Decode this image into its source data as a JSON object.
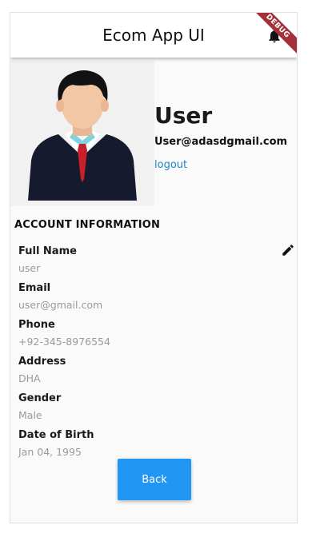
{
  "appbar": {
    "title": "Ecom App UI",
    "notification_icon": "bell-icon",
    "debug_label": "DEBUG"
  },
  "profile": {
    "name": "User",
    "email": "User@adasdgmail.com",
    "logout_label": "logout",
    "avatar_icon": "businessman-avatar"
  },
  "account": {
    "section_title": "ACCOUNT INFORMATION",
    "edit_icon": "pencil-icon",
    "fields": [
      {
        "label": "Full Name",
        "value": "user"
      },
      {
        "label": "Email",
        "value": "user@gmail.com"
      },
      {
        "label": "Phone",
        "value": "+92-345-8976554"
      },
      {
        "label": "Address",
        "value": "DHA"
      },
      {
        "label": "Gender",
        "value": "Male"
      },
      {
        "label": "Date of Birth",
        "value": "Jan 04, 1995"
      }
    ]
  },
  "actions": {
    "back_label": "Back"
  },
  "colors": {
    "accent": "#2196f3",
    "link": "#1e88c7",
    "debug_ribbon": "#a3313a"
  }
}
